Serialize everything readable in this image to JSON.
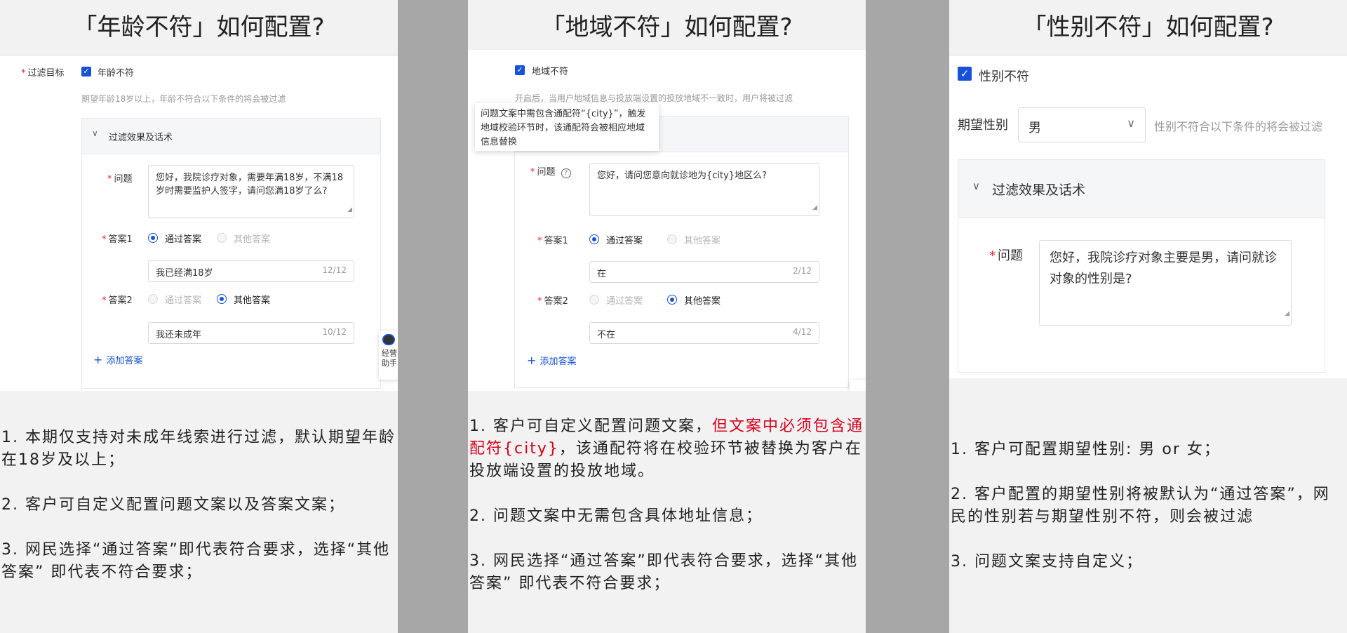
{
  "age": {
    "title": "「年龄不符」如何配置?",
    "filter_target_label": "过滤目标",
    "checkbox_label": "年龄不符",
    "hint": "期望年龄18岁以上，年龄不符合以下条件的将会被过滤",
    "group_title": "过滤效果及话术",
    "question_label": "问题",
    "question_text": "您好，我院诊疗对象，需要年满18岁，不满18岁时需要监护人签字，请问您满18岁了么?",
    "answer1_label": "答案1",
    "answer2_label": "答案2",
    "pass_answer": "通过答案",
    "other_answer": "其他答案",
    "answer1_value": "我已经满18岁",
    "answer1_count": "12/12",
    "answer2_value": "我还未成年",
    "answer2_count": "10/12",
    "add_answer": "添加答案",
    "float_label_1": "经营",
    "float_label_2": "助手",
    "notes": [
      "1. 本期仅支持对未成年线索进行过滤，默认期望年龄在18岁及以上；",
      "2. 客户可自定义配置问题文案以及答案文案；",
      "3. 网民选择“通过答案”即代表符合要求，选择“其他答案” 即代表不符合要求；"
    ]
  },
  "region": {
    "title": "「地域不符」如何配置?",
    "checkbox_label": "地域不符",
    "hint": "开启后，当用户地域信息与投放端设置的投放地域不一致时，用户将被过滤",
    "tooltip_text": "问题文案中需包含通配符“{city}”，触发地域校验环节时，该通配符会被相应地域信息替换",
    "question_label": "问题",
    "question_text": "您好，请问您意向就诊地为{city}地区么?",
    "answer1_label": "答案1",
    "answer2_label": "答案2",
    "pass_answer": "通过答案",
    "other_answer": "其他答案",
    "answer1_value": "在",
    "answer1_count": "2/12",
    "answer2_value": "不在",
    "answer2_count": "4/12",
    "add_answer": "添加答案",
    "note1_prefix": "1. 客户可自定义配置问题文案，",
    "note1_red": "但文案中必须包含通配符{city}",
    "note1_suffix": "，该通配符将在校验环节被替换为客户在投放端设置的投放地域。",
    "note2": "2. 问题文案中无需包含具体地址信息；",
    "note3": "3. 网民选择“通过答案”即代表符合要求，选择“其他答案” 即代表不符合要求；"
  },
  "gender": {
    "title": "「性别不符」如何配置?",
    "checkbox_label": "性别不符",
    "expected_label": "期望性别",
    "expected_value": "男",
    "hint": "性别不符合以下条件的将会被过滤",
    "group_title": "过滤效果及话术",
    "question_label": "问题",
    "question_text": "您好，我院诊疗对象主要是男，请问就诊对象的性别是?",
    "notes": [
      "1. 客户可配置期望性别: 男 or 女；",
      "2. 客户配置的期望性别将被默认为“通过答案”，网民的性别若与期望性别不符，则会被过滤",
      "3. 问题文案支持自定义；"
    ]
  },
  "colors": {
    "primary": "#1652d9",
    "required": "#f5222d",
    "highlight": "#d9001b"
  }
}
